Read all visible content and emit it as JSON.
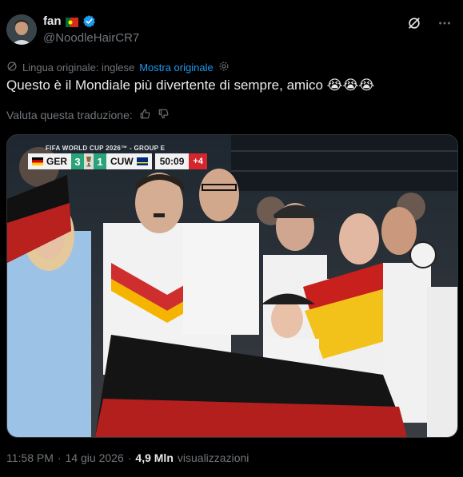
{
  "author": {
    "display_name": "fan",
    "handle": "@NoodleHairCR7",
    "flag_icon": "portugal-flag-icon",
    "verified_icon": "verified-badge-icon"
  },
  "header_actions": {
    "grok_icon": "grok-icon",
    "more_icon": "more-options-icon"
  },
  "translation": {
    "original_language": "Lingua originale: inglese",
    "show_original_label": "Mostra originale"
  },
  "tweet": {
    "text": "Questo è il Mondiale più divertente di sempre, amico 😭😭😭"
  },
  "rate_translation": {
    "label": "Valuta questa traduzione:"
  },
  "media": {
    "scorebug": {
      "title": "FIFA WORLD CUP 2026™ - GROUP E",
      "home_team": "GER",
      "home_score": "3",
      "away_score": "1",
      "away_team": "CUW",
      "clock": "50:09",
      "added_time": "+4"
    }
  },
  "meta": {
    "time": "11:58 PM",
    "separator": "·",
    "date": "14 giu 2026",
    "views_count": "4,9 Mln",
    "views_label": "visualizzazioni"
  },
  "colors": {
    "background": "#000000",
    "text_primary": "#e7e9ea",
    "text_secondary": "#71767b",
    "link": "#1d9bf0",
    "score_green": "#2aa37a",
    "added_time_red": "#d3262e"
  }
}
